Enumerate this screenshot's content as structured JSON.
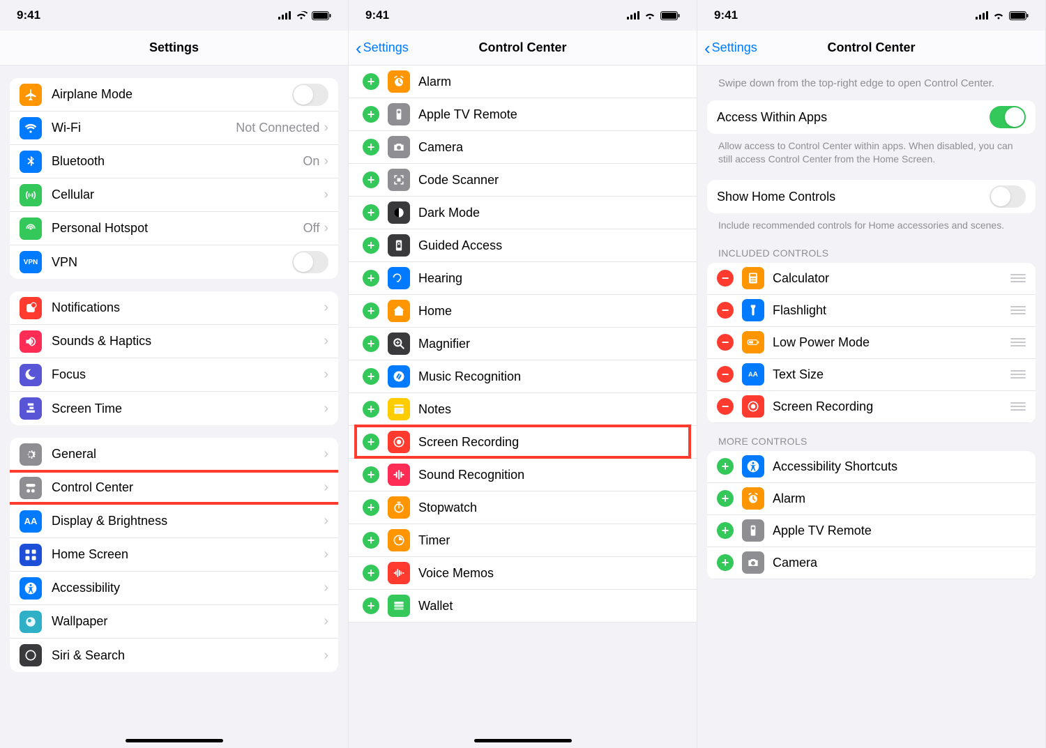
{
  "status": {
    "time": "9:41"
  },
  "phone1": {
    "title": "Settings",
    "group1": [
      {
        "label": "Airplane Mode",
        "detail": "",
        "toggle": "off",
        "icon": "airplane-icon",
        "bg": "bg-orange"
      },
      {
        "label": "Wi-Fi",
        "detail": "Not Connected",
        "chevron": true,
        "icon": "wifi-icon",
        "bg": "bg-blue"
      },
      {
        "label": "Bluetooth",
        "detail": "On",
        "chevron": true,
        "icon": "bluetooth-icon",
        "bg": "bg-blue"
      },
      {
        "label": "Cellular",
        "detail": "",
        "chevron": true,
        "icon": "cellular-icon",
        "bg": "bg-green"
      },
      {
        "label": "Personal Hotspot",
        "detail": "Off",
        "chevron": true,
        "icon": "hotspot-icon",
        "bg": "bg-green"
      },
      {
        "label": "VPN",
        "detail": "",
        "toggle": "off",
        "icon": "vpn-icon",
        "bg": "bg-blue",
        "vpntext": "VPN"
      }
    ],
    "group2": [
      {
        "label": "Notifications",
        "icon": "notifications-icon",
        "bg": "bg-red"
      },
      {
        "label": "Sounds & Haptics",
        "icon": "sounds-icon",
        "bg": "bg-pink"
      },
      {
        "label": "Focus",
        "icon": "focus-icon",
        "bg": "bg-indigo"
      },
      {
        "label": "Screen Time",
        "icon": "screentime-icon",
        "bg": "bg-indigo"
      }
    ],
    "group3": [
      {
        "label": "General",
        "icon": "general-icon",
        "bg": "bg-gray"
      },
      {
        "label": "Control Center",
        "icon": "controlcenter-icon",
        "bg": "bg-gray",
        "highlight": true
      },
      {
        "label": "Display & Brightness",
        "icon": "display-icon",
        "bg": "bg-blue",
        "textAA": "AA"
      },
      {
        "label": "Home Screen",
        "icon": "homescreen-icon",
        "bg": "bg-darkblue"
      },
      {
        "label": "Accessibility",
        "icon": "accessibility-icon",
        "bg": "bg-blue"
      },
      {
        "label": "Wallpaper",
        "icon": "wallpaper-icon",
        "bg": "bg-teal"
      },
      {
        "label": "Siri & Search",
        "icon": "siri-icon",
        "bg": "bg-darkgray"
      }
    ]
  },
  "phone2": {
    "back": "Settings",
    "title": "Control Center",
    "items": [
      {
        "label": "Alarm",
        "icon": "alarm-icon",
        "bg": "bg-orange"
      },
      {
        "label": "Apple TV Remote",
        "icon": "appletv-icon",
        "bg": "bg-gray"
      },
      {
        "label": "Camera",
        "icon": "camera-icon",
        "bg": "bg-gray"
      },
      {
        "label": "Code Scanner",
        "icon": "codescanner-icon",
        "bg": "bg-gray"
      },
      {
        "label": "Dark Mode",
        "icon": "darkmode-icon",
        "bg": "bg-darkgray"
      },
      {
        "label": "Guided Access",
        "icon": "guidedaccess-icon",
        "bg": "bg-darkgray"
      },
      {
        "label": "Hearing",
        "icon": "hearing-icon",
        "bg": "bg-blue"
      },
      {
        "label": "Home",
        "icon": "home-icon",
        "bg": "bg-orange"
      },
      {
        "label": "Magnifier",
        "icon": "magnifier-icon",
        "bg": "bg-darkgray"
      },
      {
        "label": "Music Recognition",
        "icon": "shazam-icon",
        "bg": "bg-blue"
      },
      {
        "label": "Notes",
        "icon": "notes-icon",
        "bg": "bg-yellow"
      },
      {
        "label": "Screen Recording",
        "icon": "screenrecording-icon",
        "bg": "bg-red",
        "highlight": true
      },
      {
        "label": "Sound Recognition",
        "icon": "soundrecognition-icon",
        "bg": "bg-pink"
      },
      {
        "label": "Stopwatch",
        "icon": "stopwatch-icon",
        "bg": "bg-orange"
      },
      {
        "label": "Timer",
        "icon": "timer-icon",
        "bg": "bg-orange"
      },
      {
        "label": "Voice Memos",
        "icon": "voicememos-icon",
        "bg": "bg-red"
      },
      {
        "label": "Wallet",
        "icon": "wallet-icon",
        "bg": "bg-green"
      }
    ]
  },
  "phone3": {
    "back": "Settings",
    "title": "Control Center",
    "intro": "Swipe down from the top-right edge to open Control Center.",
    "accessRow": {
      "label": "Access Within Apps",
      "toggle": "on"
    },
    "accessFooter": "Allow access to Control Center within apps. When disabled, you can still access Control Center from the Home Screen.",
    "homeRow": {
      "label": "Show Home Controls",
      "toggle": "off"
    },
    "homeFooter": "Include recommended controls for Home accessories and scenes.",
    "includedHeader": "Included Controls",
    "included": [
      {
        "label": "Calculator",
        "icon": "calculator-icon",
        "bg": "bg-orange"
      },
      {
        "label": "Flashlight",
        "icon": "flashlight-icon",
        "bg": "bg-blue"
      },
      {
        "label": "Low Power Mode",
        "icon": "lowpower-icon",
        "bg": "bg-orange"
      },
      {
        "label": "Text Size",
        "icon": "textsize-icon",
        "bg": "bg-blue",
        "textAA": "AA"
      },
      {
        "label": "Screen Recording",
        "icon": "screenrecording-icon",
        "bg": "bg-red"
      }
    ],
    "moreHeader": "More Controls",
    "more": [
      {
        "label": "Accessibility Shortcuts",
        "icon": "accessibility-icon",
        "bg": "bg-blue"
      },
      {
        "label": "Alarm",
        "icon": "alarm-icon",
        "bg": "bg-orange"
      },
      {
        "label": "Apple TV Remote",
        "icon": "appletv-icon",
        "bg": "bg-gray"
      },
      {
        "label": "Camera",
        "icon": "camera-icon",
        "bg": "bg-gray"
      }
    ]
  }
}
